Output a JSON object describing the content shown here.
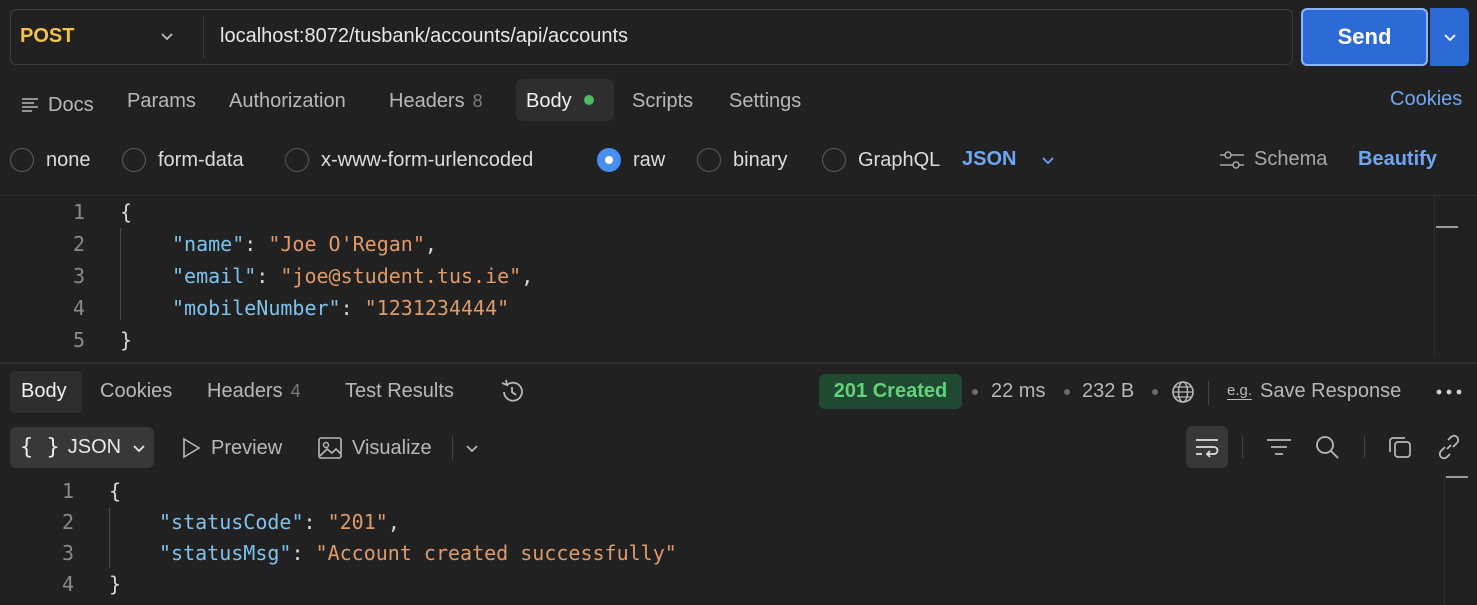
{
  "request": {
    "method": "POST",
    "url": "localhost:8072/tusbank/accounts/api/accounts",
    "send_label": "Send"
  },
  "request_tabs": [
    {
      "label": "Docs"
    },
    {
      "label": "Params"
    },
    {
      "label": "Authorization"
    },
    {
      "label": "Headers",
      "count": "8"
    },
    {
      "label": "Body",
      "active": true
    },
    {
      "label": "Scripts"
    },
    {
      "label": "Settings"
    }
  ],
  "cookies_link": "Cookies",
  "body_types": [
    "none",
    "form-data",
    "x-www-form-urlencoded",
    "raw",
    "binary",
    "GraphQL"
  ],
  "body_type_selected": "raw",
  "raw_format": "JSON",
  "schema_label": "Schema",
  "beautify_label": "Beautify",
  "request_body": {
    "line_numbers": [
      "1",
      "2",
      "3",
      "4",
      "5"
    ],
    "open": "{",
    "close": "}",
    "fields": [
      {
        "key": "\"name\"",
        "value": "\"Joe O'Regan\"",
        "trail": ","
      },
      {
        "key": "\"email\"",
        "value": "\"joe@student.tus.ie\"",
        "trail": ","
      },
      {
        "key": "\"mobileNumber\"",
        "value": "\"1231234444\"",
        "trail": ""
      }
    ]
  },
  "response_tabs": [
    {
      "label": "Body",
      "active": true
    },
    {
      "label": "Cookies"
    },
    {
      "label": "Headers",
      "count": "4"
    },
    {
      "label": "Test Results"
    }
  ],
  "response_meta": {
    "status": "201 Created",
    "time": "22 ms",
    "size": "232 B",
    "save_label": "Save Response",
    "eg_label": "e.g."
  },
  "response_toolbar": {
    "format_label": "JSON",
    "preview_label": "Preview",
    "visualize_label": "Visualize"
  },
  "response_body": {
    "line_numbers": [
      "1",
      "2",
      "3",
      "4"
    ],
    "open": "{",
    "close": "}",
    "fields": [
      {
        "key": "\"statusCode\"",
        "value": "\"201\"",
        "trail": ","
      },
      {
        "key": "\"statusMsg\"",
        "value": "\"Account created successfully\"",
        "trail": ""
      }
    ]
  },
  "colors": {
    "accent": "#2c6bd6",
    "link": "#6ea6f4",
    "method": "#f2c14e",
    "status_ok": "#64d27a",
    "json_key": "#7fc2ec",
    "json_string": "#dd9a6b"
  }
}
